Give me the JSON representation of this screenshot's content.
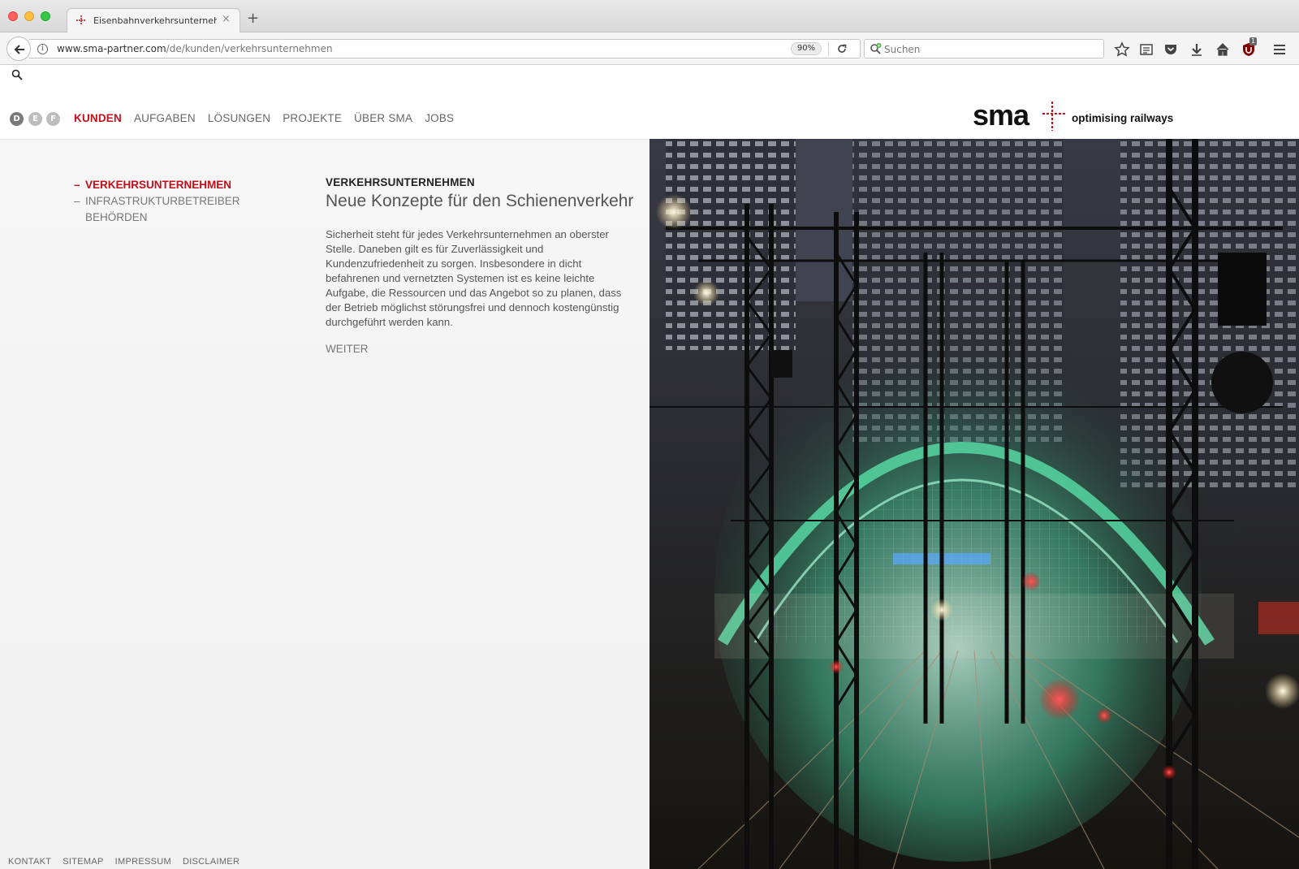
{
  "browser": {
    "tab": {
      "title": "Eisenbahnverkehrsunternehmen",
      "close_symbol": "×"
    },
    "new_tab_symbol": "+",
    "url": {
      "host": "www.sma-partner.com",
      "path": "/de/kunden/verkehrsunternehmen"
    },
    "zoom": "90%",
    "search_placeholder": "Suchen",
    "ublock_badge": "1"
  },
  "site": {
    "languages": [
      "D",
      "E",
      "F"
    ],
    "nav": [
      "KUNDEN",
      "AUFGABEN",
      "LÖSUNGEN",
      "PROJEKTE",
      "ÜBER SMA",
      "JOBS"
    ],
    "logo_text": "sma",
    "tagline": "optimising railways",
    "subnav": [
      {
        "label": "VERKEHRSUNTERNEHMEN",
        "dash": "–"
      },
      {
        "label": "INFRASTRUKTURBETREIBER",
        "dash": "–"
      },
      {
        "label": "BEHÖRDEN",
        "dash": ""
      }
    ],
    "article": {
      "kicker": "VERKEHRSUNTERNEHMEN",
      "headline": "Neue Konzepte für den Schienenverkehr",
      "body": "Sicherheit steht für jedes Verkehrsunternehmen an oberster Stelle. Daneben gilt es für Zuverlässigkeit und Kundenzufriedenheit zu sorgen. Insbesondere in dicht befahrenen und vernetzten Systemen ist es keine leichte Aufgabe, die Ressourcen und das Angebot so zu planen, dass der Betrieb möglichst störungsfrei und dennoch kostengünstig durchgeführt werden kann.",
      "more": "WEITER"
    },
    "footer": [
      "KONTAKT",
      "SITEMAP",
      "IMPRESSUM",
      "DISCLAIMER"
    ]
  },
  "colors": {
    "accent": "#c0111b",
    "text": "#555555"
  }
}
